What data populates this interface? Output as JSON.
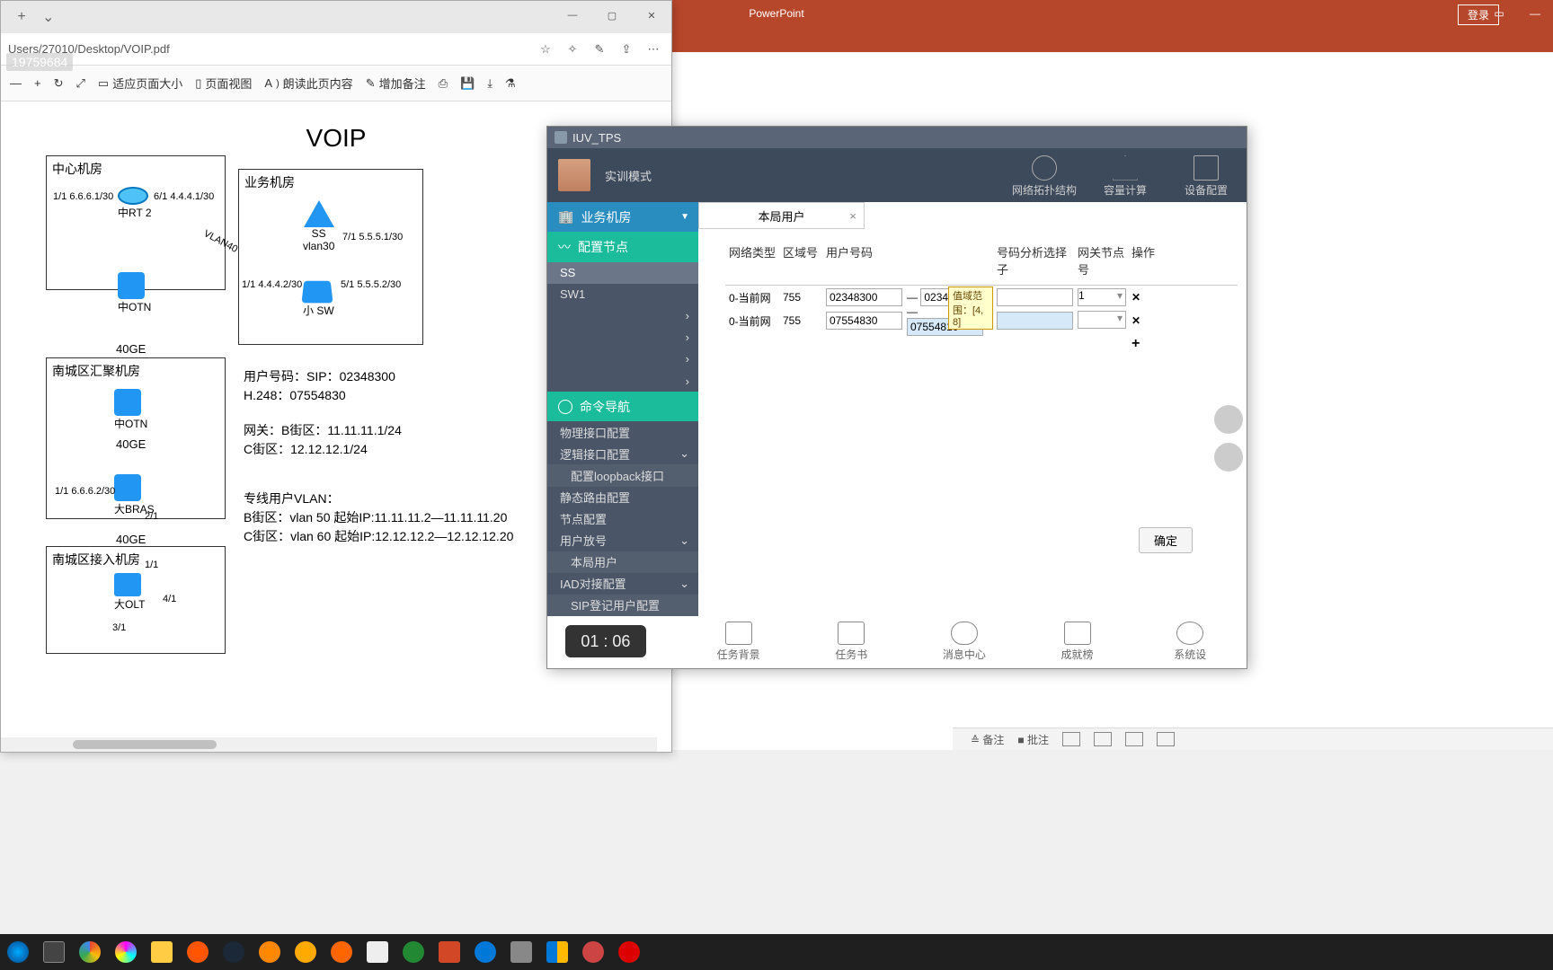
{
  "ppt": {
    "title": "PowerPoint",
    "login": "登录",
    "status_notes": "≙ 备注",
    "status_comments": "■ 批注"
  },
  "edge": {
    "url": "Users/27010/Desktop/VOIP.pdf",
    "watermark": "19759684",
    "toolbar": {
      "fit": "适应页面大小",
      "pageview": "页面视图",
      "read": "朗读此页内容",
      "annotate": "增加备注"
    }
  },
  "pdf": {
    "title": "VOIP",
    "boxes": {
      "center": "中心机房",
      "biz": "业务机房",
      "agg": "南城区汇聚机房",
      "access": "南城区接入机房"
    },
    "nodes": {
      "rt2": "中RT 2",
      "otn1": "中OTN",
      "ss": "SS",
      "ss_vlan": "vlan30",
      "sw": "小 SW",
      "otn2": "中OTN",
      "bras": "大BRAS",
      "olt": "大OLT"
    },
    "ge": {
      "a": "40GE",
      "b": "40GE",
      "c": "40GE"
    },
    "ports": {
      "p1": "1/1  6.6.6.1/30",
      "p2": "6/1  4.4.4.1/30",
      "p3": "7/1  5.5.5.1/30",
      "p4": "1/1  4.4.4.2/30",
      "p5": "5/1  5.5.5.2/30",
      "p6": "1/1  6.6.6.2/30",
      "p7": "2/1",
      "p8": "1/1",
      "p9": "4/1",
      "p10": "3/1",
      "vlan40": "VLAN40"
    },
    "cfg": {
      "line1": "用户号码：SIP：02348300",
      "line2": "H.248：07554830",
      "line3": "网关：B街区：11.11.11.1/24",
      "line4": "C街区：12.12.12.1/24",
      "line5": "专线用户VLAN：",
      "line6": "B街区：vlan 50 起始IP:11.11.11.2—11.11.11.20",
      "line7": "C街区：vlan 60 起始IP:12.12.12.2—12.12.12.20"
    }
  },
  "iuv": {
    "title": "IUV_TPS",
    "mode": "实训模式",
    "topicons": {
      "topo": "网络拓扑结构",
      "cap": "容量计算",
      "dev": "设备配置"
    },
    "location": "业务机房",
    "section_cfg": "配置节点",
    "section_cmd": "命令导航",
    "nodes": {
      "ss": "SS",
      "sw": "SW1"
    },
    "menu": {
      "phys": "物理接口配置",
      "logic": "逻辑接口配置",
      "loopback": "配置loopback接口",
      "static": "静态路由配置",
      "node": "节点配置",
      "user": "用户放号",
      "local": "本局用户",
      "iad": "IAD对接配置",
      "sip": "SIP登记用户配置"
    },
    "tab": "本局用户",
    "headers": {
      "nettype": "网络类型",
      "area": "区域号",
      "number": "用户号码",
      "analyzer": "号码分析选择子",
      "gateway": "网关节点号",
      "ops": "操作"
    },
    "rows": [
      {
        "type": "0-当前网",
        "area": "755",
        "num_from": "02348300",
        "num_to": "02348",
        "sel": "1"
      },
      {
        "type": "0-当前网",
        "area": "755",
        "num_from": "07554830",
        "num_to": "07554810",
        "sel": ""
      }
    ],
    "tooltip": "值域范围：[4, 8]",
    "ok": "确定",
    "timer": "01 : 06",
    "bottom": {
      "bg": "任务背景",
      "book": "任务书",
      "msg": "消息中心",
      "rank": "成就榜",
      "sys": "系统设"
    }
  }
}
